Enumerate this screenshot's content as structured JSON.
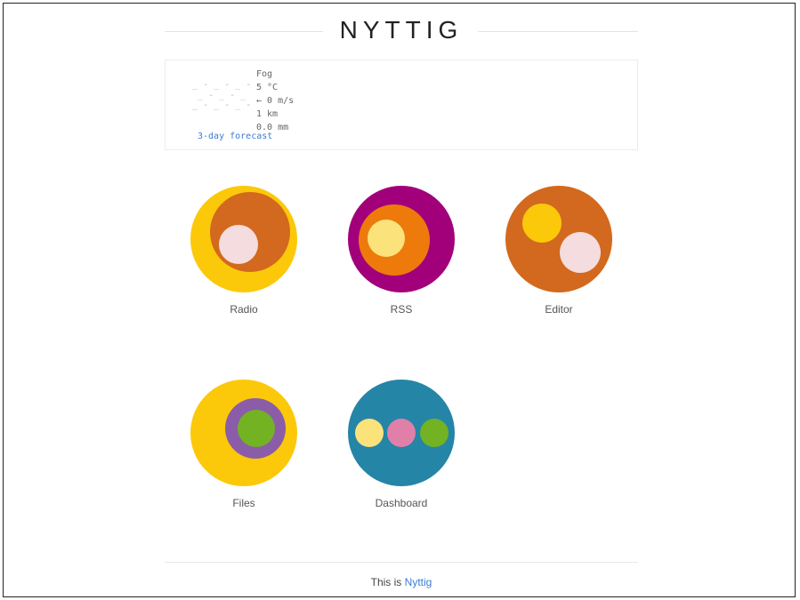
{
  "header": {
    "title": "NYTTIG"
  },
  "weather": {
    "condition": "Fog",
    "temperature": "5 °C",
    "wind": "← 0 m/s",
    "visibility": "1 km",
    "precipitation": "0.0 mm",
    "forecast_link": "3-day forecast"
  },
  "apps": [
    {
      "label": "Radio",
      "icon": "radio-icon"
    },
    {
      "label": "RSS",
      "icon": "rss-icon"
    },
    {
      "label": "Editor",
      "icon": "editor-icon"
    },
    {
      "label": "Files",
      "icon": "files-icon"
    },
    {
      "label": "Dashboard",
      "icon": "dashboard-icon"
    }
  ],
  "footer": {
    "prefix": "This is",
    "link": "Nyttig"
  },
  "colors": {
    "yellow": "#fcc80a",
    "orange": "#d2691e",
    "pink_light": "#f4dcdf",
    "magenta": "#a2007a",
    "bright_orange": "#ee7a0c",
    "pale_yellow": "#fbe27b",
    "purple": "#8b5da8",
    "green": "#73b222",
    "teal": "#2585a6",
    "rose": "#e080a8",
    "link": "#3a7bd5"
  }
}
